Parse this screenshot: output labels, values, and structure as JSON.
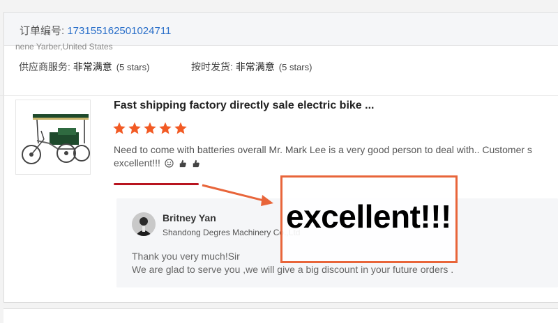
{
  "order": {
    "label": "订单编号: ",
    "number": "173155162501024711"
  },
  "buyer": {
    "name_country": "nene Yarber,United States"
  },
  "ratings": [
    {
      "label": "供应商服务: ",
      "value": "非常满意",
      "stars": "(5 stars)"
    },
    {
      "label": "按时发货: ",
      "value": "非常满意",
      "stars": "(5 stars)"
    }
  ],
  "product": {
    "title": "Fast shipping factory directly sale electric bike ...",
    "image_icon": "electric-tricycle-image"
  },
  "review": {
    "star_count": 5,
    "star_color": "#f25a24",
    "line1": "Need to come with batteries overall Mr. Mark Lee is a very good person to deal with.. Customer s",
    "line2": "excellent!!!"
  },
  "reply": {
    "name": "Britney Yan",
    "company": "Shandong Degres Machinery Co.,Ltd",
    "text_line1": "Thank you very much!Sir",
    "text_line2": "We are glad to serve you ,we will give a big discount in your future orders ."
  },
  "annotation": {
    "callout_text": "excellent!!!",
    "box_color": "#e8653a",
    "underline_color": "#b8141f"
  }
}
